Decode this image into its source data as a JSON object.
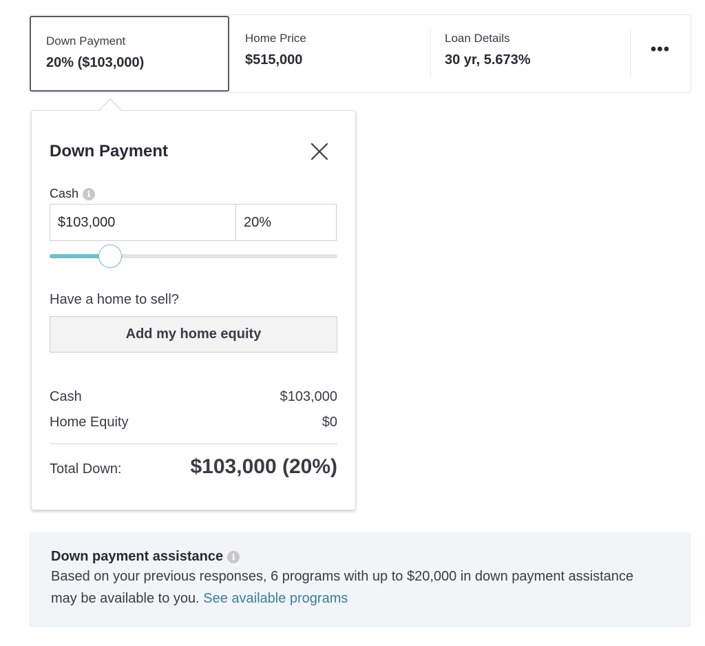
{
  "summary_bar": {
    "down_payment": {
      "label": "Down Payment",
      "value": "20% ($103,000)"
    },
    "home_price": {
      "label": "Home Price",
      "value": "$515,000"
    },
    "loan_details": {
      "label": "Loan Details",
      "value": "30 yr, 5.673%"
    },
    "more_icon": "ellipsis-icon",
    "more_text": "•••"
  },
  "popover": {
    "title": "Down Payment",
    "close_icon": "close-icon",
    "cash_label": "Cash",
    "info_icon": "info-icon",
    "info_glyph": "i",
    "cash_amount_value": "$103,000",
    "cash_percent_value": "20%",
    "slider_percent": 20,
    "slider_color": "#6fbfcb",
    "home_question": "Have a home to sell?",
    "equity_button_label": "Add my home equity",
    "summary": {
      "cash_label": "Cash",
      "cash_value": "$103,000",
      "equity_label": "Home Equity",
      "equity_value": "$0",
      "total_label": "Total Down:",
      "total_value": "$103,000 (20%)"
    }
  },
  "assistance": {
    "title": "Down payment assistance",
    "body": "Based on your previous responses, 6 programs with up to $20,000 in down payment assistance may be available to you.",
    "link_label": "See available programs",
    "link_color": "#3a7ea0",
    "background": "#f1f5f8"
  }
}
